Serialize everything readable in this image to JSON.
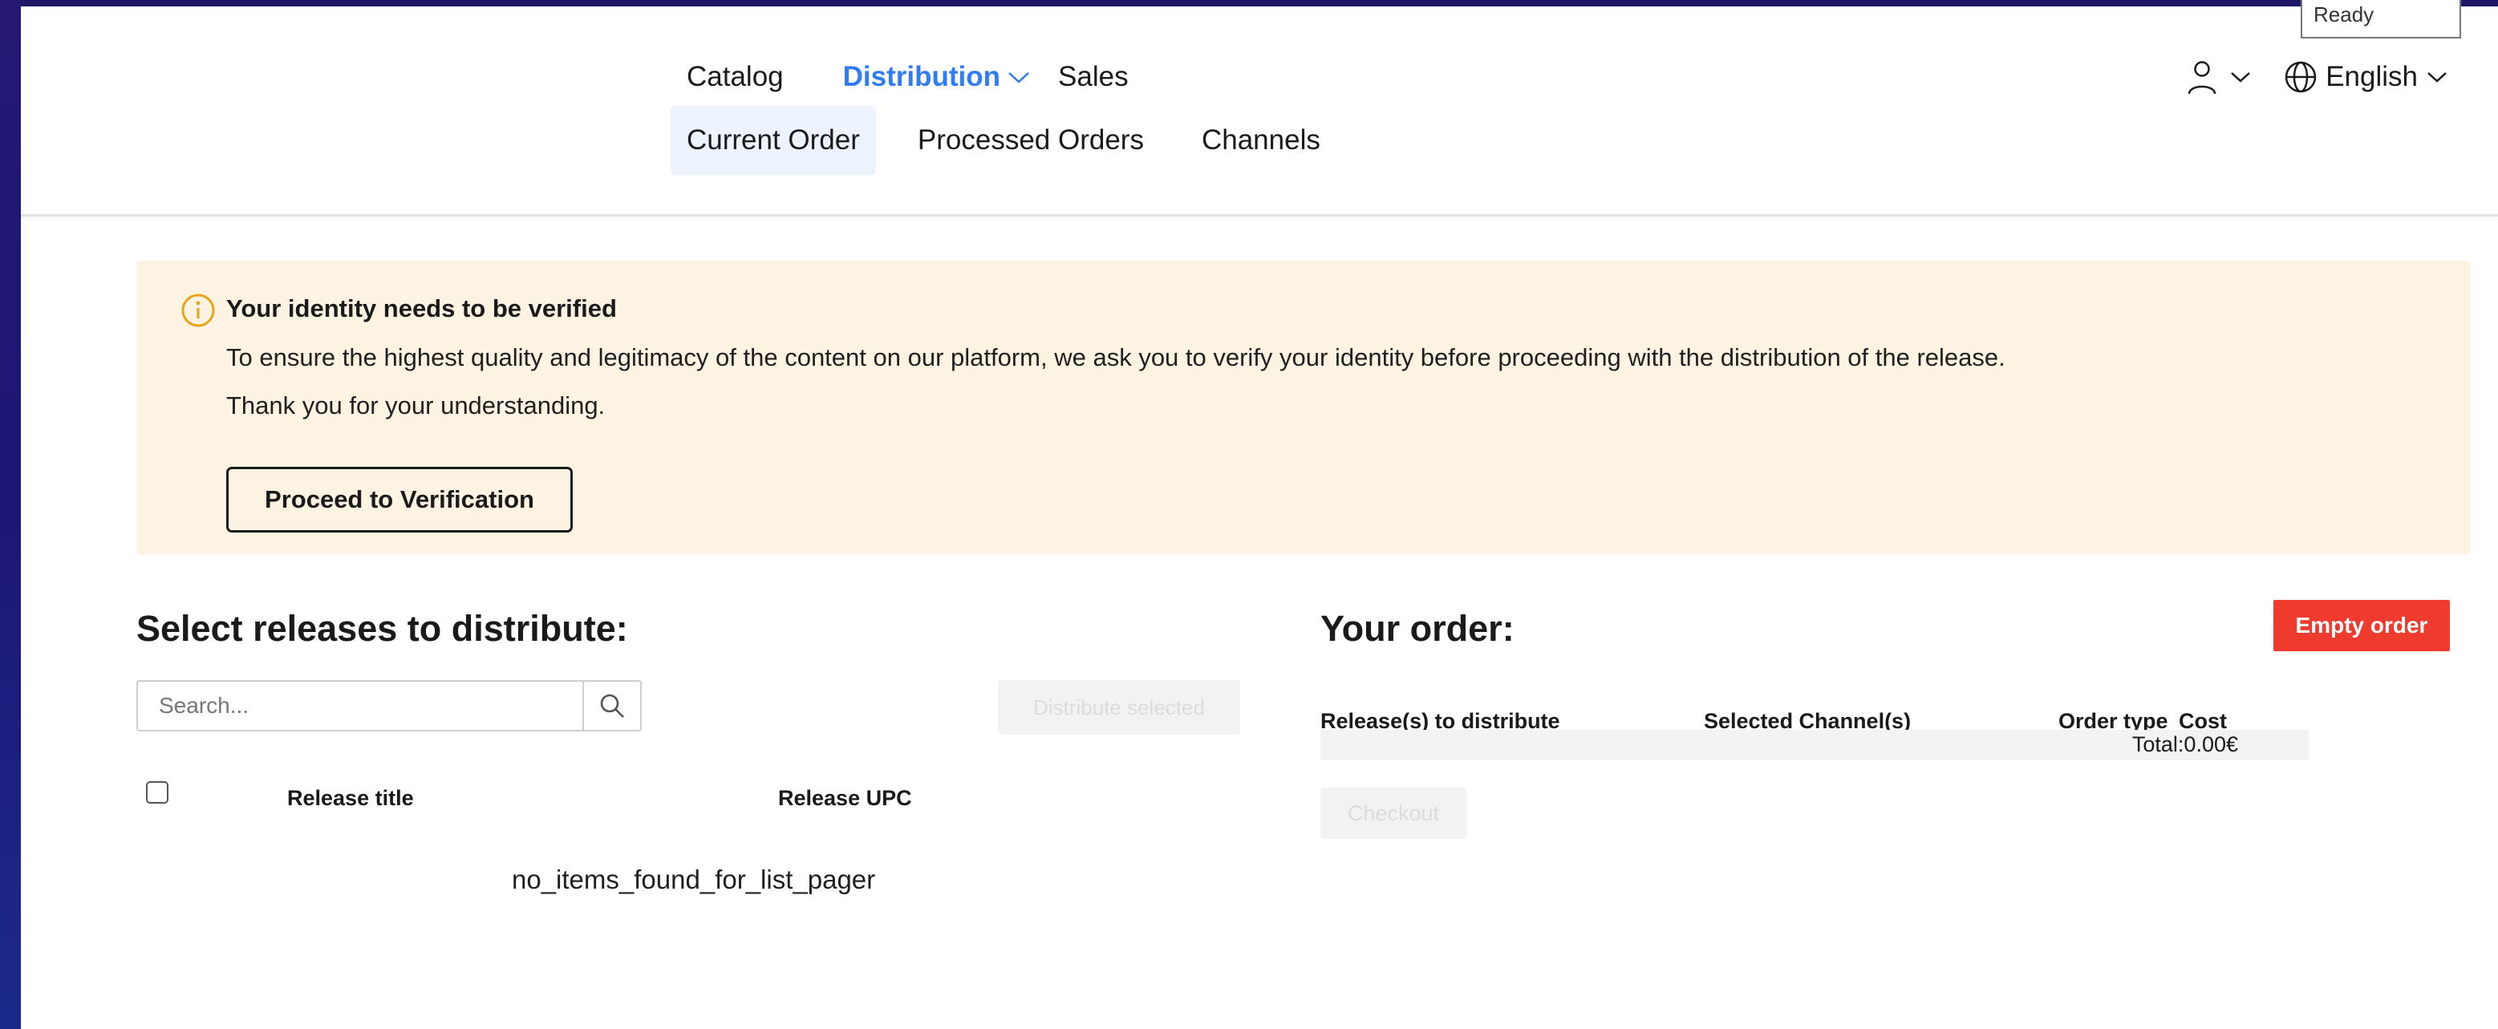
{
  "status": {
    "ready": "Ready"
  },
  "nav": {
    "main": [
      {
        "label": "Catalog",
        "active": false
      },
      {
        "label": "Distribution",
        "active": true
      },
      {
        "label": "Sales",
        "active": false
      }
    ],
    "sub": [
      {
        "label": "Current Order",
        "active": true
      },
      {
        "label": "Processed Orders",
        "active": false
      },
      {
        "label": "Channels",
        "active": false
      }
    ],
    "language": "English"
  },
  "alert": {
    "title": "Your identity needs to be verified",
    "line1": "To ensure the highest quality and legitimacy of the content on our platform, we ask you to verify your identity before proceeding with the distribution of the release.",
    "line2": "Thank you for your understanding.",
    "button": "Proceed to Verification",
    "icon": "info-icon"
  },
  "releases": {
    "title": "Select releases to distribute:",
    "search_placeholder": "Search...",
    "distribute_button": "Distribute selected",
    "columns": [
      "Release title",
      "Release UPC"
    ],
    "empty_message": "no_items_found_for_list_pager"
  },
  "order": {
    "title": "Your order:",
    "empty_button": "Empty order",
    "columns": [
      "Release(s) to distribute",
      "Selected Channel(s)",
      "Order type",
      "Cost"
    ],
    "total": "Total:0.00€",
    "checkout_button": "Checkout"
  },
  "colors": {
    "accent": "#2f7cf6",
    "danger": "#ee3b2e",
    "alert_bg": "#fdf3e2",
    "info_icon": "#e8a317",
    "frame": "#1b1368"
  }
}
